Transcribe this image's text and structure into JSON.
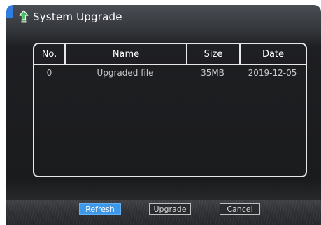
{
  "title": "System Upgrade",
  "icons": {
    "title": "upgrade-arrow-icon"
  },
  "colors": {
    "accent": "#2f7de0",
    "icon": "#3fc35a",
    "primary_button": "#3f97e8"
  },
  "table": {
    "headers": {
      "no": "No.",
      "name": "Name",
      "size": "Size",
      "date": "Date"
    },
    "rows": [
      {
        "no": "0",
        "name": "Upgraded file",
        "size": "35MB",
        "date": "2019-12-05"
      }
    ]
  },
  "buttons": {
    "refresh": "Refresh",
    "upgrade": "Upgrade",
    "cancel": "Cancel"
  }
}
